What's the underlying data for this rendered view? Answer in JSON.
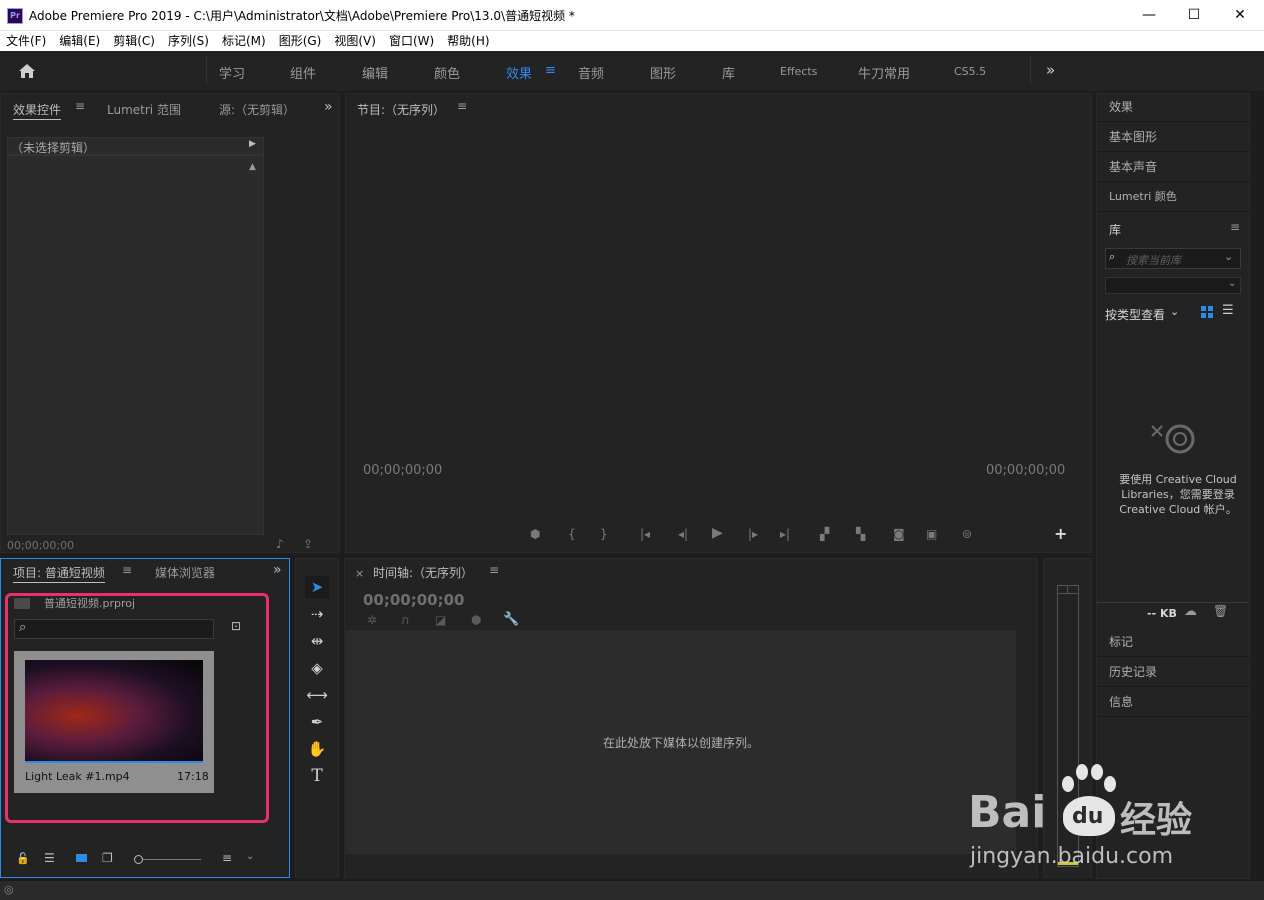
{
  "window": {
    "title": "Adobe Premiere Pro 2019 - C:\\用户\\Administrator\\文档\\Adobe\\Premiere Pro\\13.0\\普通短视频 *",
    "app_icon": "Pr",
    "minimize": "—",
    "maximize": "☐",
    "close": "✕"
  },
  "menu": [
    "文件(F)",
    "编辑(E)",
    "剪辑(C)",
    "序列(S)",
    "标记(M)",
    "图形(G)",
    "视图(V)",
    "窗口(W)",
    "帮助(H)"
  ],
  "workspaces": {
    "home_icon": "home-icon",
    "tabs": [
      "学习",
      "组件",
      "编辑",
      "颜色",
      "效果",
      "音频",
      "图形",
      "库",
      "Effects",
      "牛刀常用",
      "CS5.5"
    ],
    "active": "效果",
    "more": "»"
  },
  "source_panel": {
    "tabs": [
      "效果控件",
      "Lumetri 范围",
      "源:（无剪辑）"
    ],
    "clip_header": "（未选择剪辑）",
    "timecode": "00;00;00;00"
  },
  "program_panel": {
    "title": "节目:（无序列）",
    "timecode_left": "00;00;00;00",
    "timecode_right": "00;00;00;00"
  },
  "right_panels": {
    "items": [
      "效果",
      "基本图形",
      "基本声音",
      "Lumetri 颜色"
    ],
    "library_title": "库",
    "search_placeholder": "搜索当前库",
    "view_by": "按类型查看",
    "cc_message": "要使用 Creative Cloud Libraries，您需要登录 Creative Cloud 帐户。",
    "kb": "-- KB",
    "bottom_items": [
      "标记",
      "历史记录",
      "信息"
    ]
  },
  "project_panel": {
    "tabs": [
      "项目: 普通短视频",
      "媒体浏览器"
    ],
    "file": "普通短视频.prproj",
    "clip_name": "Light Leak #1.mp4",
    "clip_duration": "17:18"
  },
  "timeline": {
    "title": "时间轴:（无序列）",
    "close": "×",
    "timecode": "00;00;00;00",
    "drop_message": "在此处放下媒体以创建序列。"
  },
  "watermark": {
    "brand": "Bai",
    "brand2": "du",
    "brand_cn": "经验",
    "url": "jingyan.baidu.com"
  },
  "colors": {
    "accent": "#2d8ceb",
    "highlight_box": "#e8306a",
    "panel_bg": "#232323"
  }
}
